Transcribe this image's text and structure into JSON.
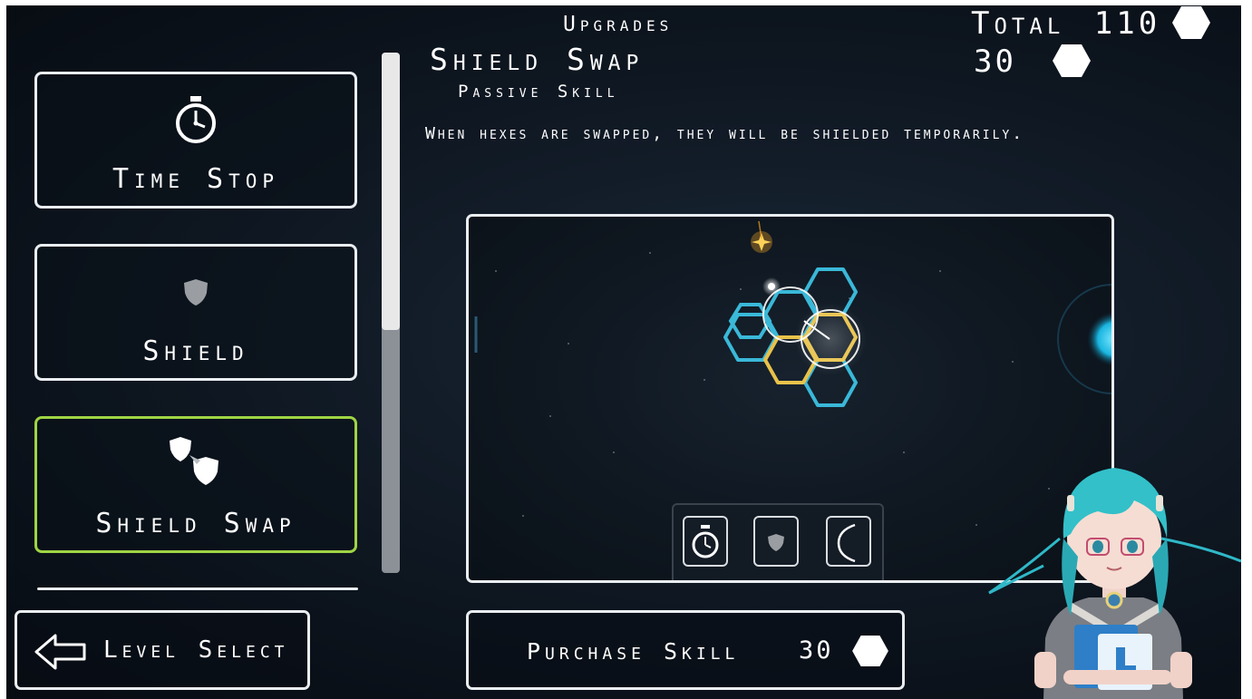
{
  "header": {
    "title": "Upgrades",
    "total_label": "Total",
    "total_value": "110",
    "cost_value": "30"
  },
  "detail": {
    "skill_name": "Shield Swap",
    "skill_type": "Passive Skill",
    "description": "When hexes are swapped, they will be shielded temporarily."
  },
  "skill_list": [
    {
      "label": "Time Stop",
      "icon": "stopwatch-icon",
      "selected": false
    },
    {
      "label": "Shield",
      "icon": "shield-icon",
      "selected": false
    },
    {
      "label": "Shield Swap",
      "icon": "shield-swap-icon",
      "selected": true
    }
  ],
  "buttons": {
    "level_select": "Level Select",
    "purchase": "Purchase Skill",
    "purchase_cost": "30"
  },
  "preview": {
    "ability_bar_icons": [
      "stopwatch-icon",
      "shield-icon",
      "crescent-icon"
    ]
  },
  "colors": {
    "selected_border": "#9fd444",
    "hex_cyan": "#3ab8d8",
    "hex_yellow": "#e8c24a",
    "background": "#0b121b"
  }
}
